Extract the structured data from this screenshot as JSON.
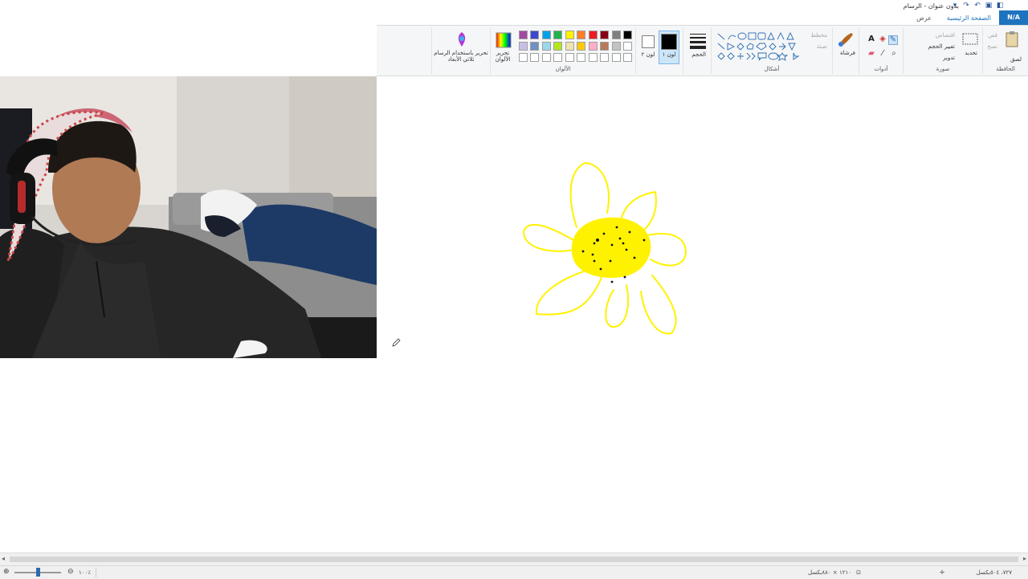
{
  "window": {
    "title": "بدون عنوان - الرسام"
  },
  "ribbon_tabs": {
    "file": "N/A",
    "home": "الصفحة الرئيسية",
    "view": "عرض"
  },
  "clipboard": {
    "paste": "لصق",
    "cut": "قص",
    "copy": "نسخ",
    "group": "الحافظة"
  },
  "image": {
    "select": "تحديد",
    "crop": "اقتصاص",
    "resize": "تغيير الحجم",
    "rotate": "تدوير",
    "group": "صورة"
  },
  "tools": {
    "group": "أدوات"
  },
  "brushes": {
    "label": "فرشاة"
  },
  "shapes": {
    "outline": "مخطط",
    "fill": "تعبئة",
    "group": "أشكال"
  },
  "size": {
    "label": "الحجم"
  },
  "color1": {
    "label": "لون ١",
    "value": "#000000"
  },
  "color2": {
    "label": "لون ٢",
    "value": "#ffffff"
  },
  "colors": {
    "group": "الألوان",
    "edit": "تحرير الألوان",
    "row1": [
      "#000000",
      "#7f7f7f",
      "#880015",
      "#ed1c24",
      "#ff7f27",
      "#fff200",
      "#22b14c",
      "#00a2e8",
      "#3f48cc",
      "#a349a4"
    ],
    "row2": [
      "#ffffff",
      "#c3c3c3",
      "#b97a57",
      "#ffaec9",
      "#ffc90e",
      "#efe4b0",
      "#b5e61d",
      "#99d9ea",
      "#7092be",
      "#c8bfe7"
    ],
    "row3": [
      "#ffffff",
      "#ffffff",
      "#ffffff",
      "#ffffff",
      "#ffffff",
      "#ffffff",
      "#ffffff",
      "#ffffff",
      "#ffffff",
      "#ffffff"
    ]
  },
  "paint3d": {
    "label": "تحرير باستخدام الرسام ثلاثي الأبعاد"
  },
  "drawing": {
    "stroke_color": "#fff200",
    "fill_color": "#fff200"
  },
  "status": {
    "cursor_pos": "٧٢٧، ٥٠٤بكسل",
    "canvas_size": "١٢١٠ × ٨٨٠بكسل",
    "zoom": "١٠٠٪"
  }
}
